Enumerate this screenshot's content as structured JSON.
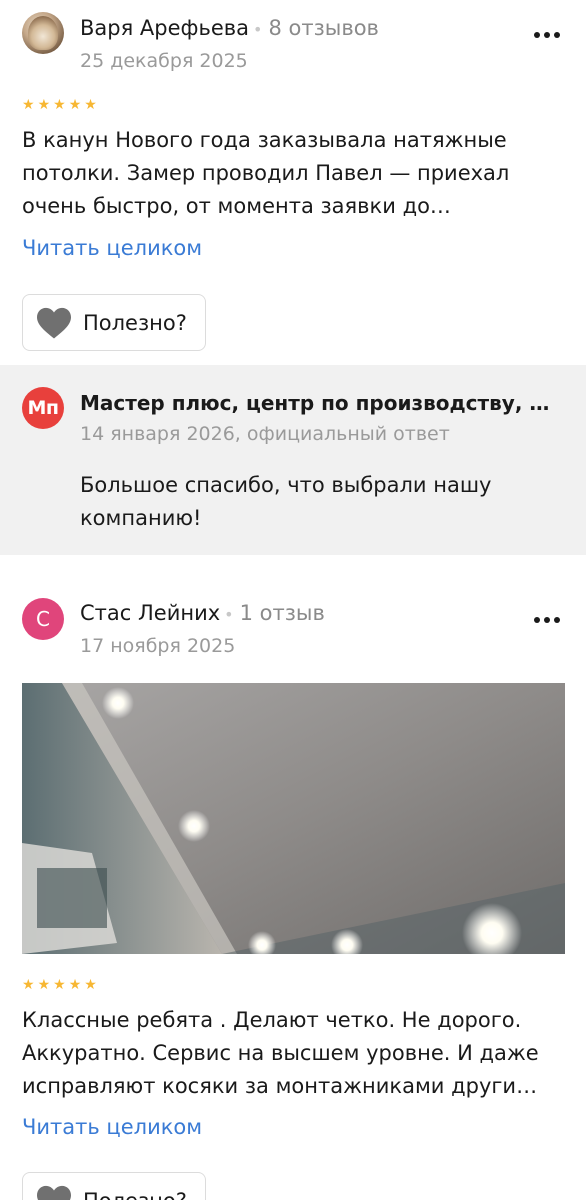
{
  "reviews": [
    {
      "author": "Варя Арефьева",
      "reviews_count": "8 отзывов",
      "date": "25 декабря 2025",
      "rating": 5,
      "text": "В канун Нового года заказывала натяжные потолки. Замер проводил Павел — приехал очень быстро, от момента заявки до…",
      "read_more": "Читать целиком",
      "useful_label": "Полезно?",
      "owner_response": {
        "avatar_initials": "Мп",
        "company": "Мастер плюс, центр по производству, …",
        "date": "14 января 2026, официальный ответ",
        "text": "Большое спасибо, что выбрали нашу компанию!"
      }
    },
    {
      "author": "Стас Лейних",
      "avatar_initial": "С",
      "reviews_count": "1 отзыв",
      "date": "17 ноября 2025",
      "rating": 5,
      "text": "Классные ребята . Делают четко. Не дорого. Аккуратно. Сервис на высшем уровне. И даже исправляют косяки за монтажниками други…",
      "read_more": "Читать целиком",
      "useful_label": "Полезно?"
    }
  ],
  "colors": {
    "star": "#f7b733",
    "link": "#3a7bd5",
    "response_bg": "#f1f1f1",
    "org_avatar": "#e8403c",
    "user_avatar": "#e0457b"
  },
  "icons": {
    "more": "more-dots-icon",
    "heart": "heart-icon",
    "star": "star-icon"
  }
}
